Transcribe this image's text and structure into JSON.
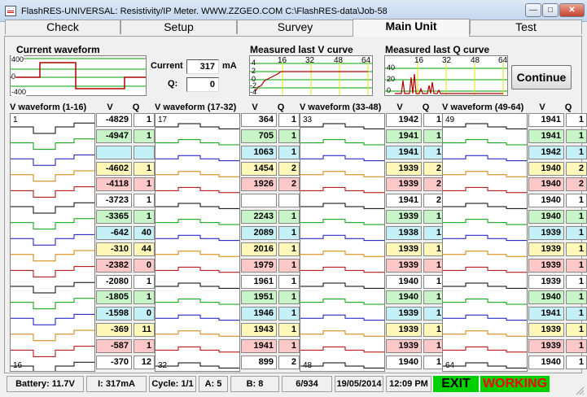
{
  "window": {
    "title": "FlashRES-UNIVERSAL: Resistivity/IP Meter.  WWW.ZZGEO.COM    C:\\FlashRES-data\\Job-58",
    "minimize": "—",
    "maximize": "□",
    "close": "✕"
  },
  "tabs": [
    {
      "label": "Check",
      "active": false
    },
    {
      "label": "Setup",
      "active": false
    },
    {
      "label": "Survey",
      "active": false
    },
    {
      "label": "Main Unit",
      "active": true
    },
    {
      "label": "Test",
      "active": false
    }
  ],
  "current_waveform": {
    "title": "Current waveform",
    "ticks": [
      "400",
      "0",
      "-400"
    ]
  },
  "current": {
    "label": "Current",
    "value": "317",
    "unit": "mA",
    "q_label": "Q:",
    "q_value": "0"
  },
  "v_curve": {
    "title": "Measured last V curve",
    "x_ticks": [
      "16",
      "32",
      "48",
      "64"
    ],
    "y_ticks": [
      "4",
      "2",
      "0",
      "-2",
      "-4"
    ]
  },
  "q_curve": {
    "title": "Measured last Q curve",
    "x_ticks": [
      "16",
      "32",
      "48",
      "64"
    ],
    "y_ticks": [
      "40",
      "20",
      "0"
    ]
  },
  "continue_label": "Continue",
  "blocks": [
    {
      "title": "V waveform (1-16)",
      "first": "1",
      "last": "16",
      "rows": [
        {
          "v": "-4829",
          "q": "1",
          "c": "white"
        },
        {
          "v": "-4947",
          "q": "1",
          "c": "green"
        },
        {
          "v": "",
          "q": "",
          "c": "cyan"
        },
        {
          "v": "-4602",
          "q": "1",
          "c": "yellow"
        },
        {
          "v": "-4118",
          "q": "1",
          "c": "red"
        },
        {
          "v": "-3723",
          "q": "1",
          "c": "white"
        },
        {
          "v": "-3365",
          "q": "1",
          "c": "green"
        },
        {
          "v": "-642",
          "q": "40",
          "c": "cyan"
        },
        {
          "v": "-310",
          "q": "44",
          "c": "yellow"
        },
        {
          "v": "-2382",
          "q": "0",
          "c": "red"
        },
        {
          "v": "-2080",
          "q": "1",
          "c": "white"
        },
        {
          "v": "-1805",
          "q": "1",
          "c": "green"
        },
        {
          "v": "-1598",
          "q": "0",
          "c": "cyan"
        },
        {
          "v": "-369",
          "q": "11",
          "c": "yellow"
        },
        {
          "v": "-587",
          "q": "1",
          "c": "red"
        },
        {
          "v": "-370",
          "q": "12",
          "c": "white"
        }
      ]
    },
    {
      "title": "V waveform (17-32)",
      "first": "17",
      "last": "32",
      "rows": [
        {
          "v": "364",
          "q": "1",
          "c": "white"
        },
        {
          "v": "705",
          "q": "1",
          "c": "green"
        },
        {
          "v": "1063",
          "q": "1",
          "c": "cyan"
        },
        {
          "v": "1454",
          "q": "2",
          "c": "yellow"
        },
        {
          "v": "1926",
          "q": "2",
          "c": "red"
        },
        {
          "v": "",
          "q": "",
          "c": "white"
        },
        {
          "v": "2243",
          "q": "1",
          "c": "green"
        },
        {
          "v": "2089",
          "q": "1",
          "c": "cyan"
        },
        {
          "v": "2016",
          "q": "1",
          "c": "yellow"
        },
        {
          "v": "1979",
          "q": "1",
          "c": "red"
        },
        {
          "v": "1961",
          "q": "1",
          "c": "white"
        },
        {
          "v": "1951",
          "q": "1",
          "c": "green"
        },
        {
          "v": "1946",
          "q": "1",
          "c": "cyan"
        },
        {
          "v": "1943",
          "q": "1",
          "c": "yellow"
        },
        {
          "v": "1941",
          "q": "1",
          "c": "red"
        },
        {
          "v": "899",
          "q": "2",
          "c": "white"
        }
      ]
    },
    {
      "title": "V waveform (33-48)",
      "first": "33",
      "last": "48",
      "rows": [
        {
          "v": "1942",
          "q": "1",
          "c": "white"
        },
        {
          "v": "1941",
          "q": "1",
          "c": "green"
        },
        {
          "v": "1941",
          "q": "1",
          "c": "cyan"
        },
        {
          "v": "1939",
          "q": "2",
          "c": "yellow"
        },
        {
          "v": "1939",
          "q": "2",
          "c": "red"
        },
        {
          "v": "1941",
          "q": "2",
          "c": "white"
        },
        {
          "v": "1939",
          "q": "1",
          "c": "green"
        },
        {
          "v": "1938",
          "q": "1",
          "c": "cyan"
        },
        {
          "v": "1939",
          "q": "1",
          "c": "yellow"
        },
        {
          "v": "1939",
          "q": "1",
          "c": "red"
        },
        {
          "v": "1940",
          "q": "1",
          "c": "white"
        },
        {
          "v": "1940",
          "q": "1",
          "c": "green"
        },
        {
          "v": "1939",
          "q": "1",
          "c": "cyan"
        },
        {
          "v": "1939",
          "q": "1",
          "c": "yellow"
        },
        {
          "v": "1939",
          "q": "1",
          "c": "red"
        },
        {
          "v": "1940",
          "q": "1",
          "c": "white"
        }
      ]
    },
    {
      "title": "V waveform (49-64)",
      "first": "49",
      "last": "64",
      "rows": [
        {
          "v": "1941",
          "q": "1",
          "c": "white"
        },
        {
          "v": "1941",
          "q": "1",
          "c": "green"
        },
        {
          "v": "1942",
          "q": "1",
          "c": "cyan"
        },
        {
          "v": "1940",
          "q": "2",
          "c": "yellow"
        },
        {
          "v": "1940",
          "q": "2",
          "c": "red"
        },
        {
          "v": "1940",
          "q": "1",
          "c": "white"
        },
        {
          "v": "1940",
          "q": "1",
          "c": "green"
        },
        {
          "v": "1939",
          "q": "1",
          "c": "cyan"
        },
        {
          "v": "1939",
          "q": "1",
          "c": "yellow"
        },
        {
          "v": "1939",
          "q": "1",
          "c": "red"
        },
        {
          "v": "1939",
          "q": "1",
          "c": "white"
        },
        {
          "v": "1940",
          "q": "1",
          "c": "green"
        },
        {
          "v": "1941",
          "q": "1",
          "c": "cyan"
        },
        {
          "v": "1939",
          "q": "1",
          "c": "yellow"
        },
        {
          "v": "1939",
          "q": "1",
          "c": "red"
        },
        {
          "v": "1940",
          "q": "1",
          "c": "white"
        }
      ]
    }
  ],
  "column_v": "V",
  "column_q": "Q",
  "status": {
    "battery": "Battery:   11.7V",
    "current": "I:  317mA",
    "cycle": "Cycle: 1/1",
    "a": "A: 5",
    "b": "B: 8",
    "count": "6/934",
    "date": "19/05/2014",
    "time": "12:09 PM",
    "exit": "EXIT",
    "working": "WORKING"
  },
  "colors": {
    "white": "#ffffff",
    "green": "#c8f5c8",
    "cyan": "#c4f0f8",
    "yellow": "#fff8b8",
    "red": "#ffc8c8",
    "wave_black": "#000000",
    "wave_green": "#00a000",
    "wave_blue": "#1010c0",
    "wave_orange": "#d08000",
    "wave_red": "#b00000"
  }
}
